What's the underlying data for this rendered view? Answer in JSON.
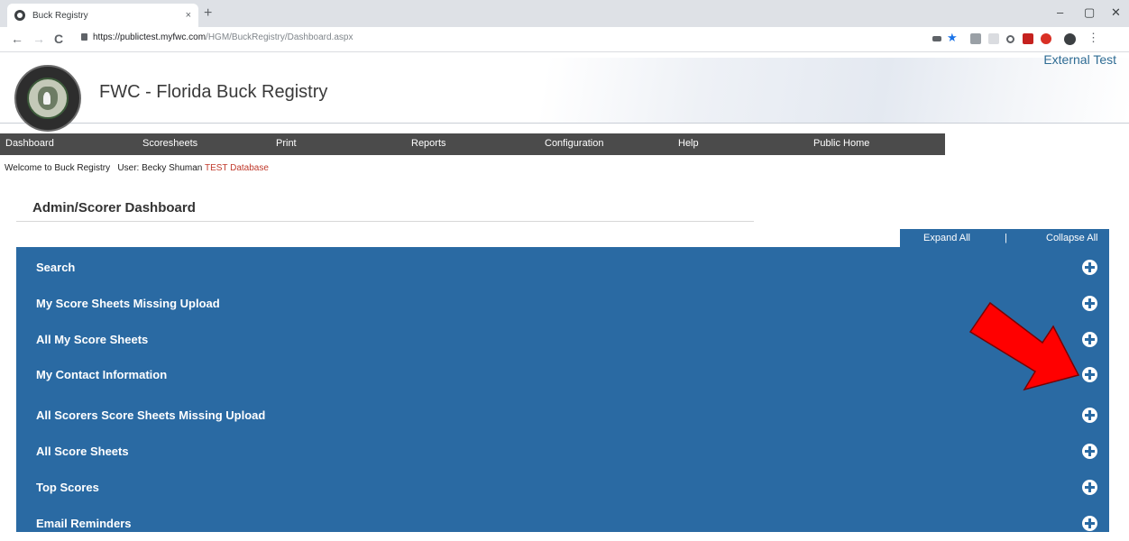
{
  "browser": {
    "tab_title": "Buck Registry",
    "tab_close": "×",
    "new_tab": "+",
    "url_host": "https://publictest.myfwc.com",
    "url_path": "/HGM/BuckRegistry/Dashboard.aspx",
    "window_min": "–",
    "window_max": "▢",
    "window_close": "✕",
    "back": "←",
    "forward": "→",
    "reload": "C"
  },
  "header": {
    "environment": "External Test",
    "site_title": "FWC - Florida Buck Registry"
  },
  "nav": {
    "items": [
      {
        "label": "Dashboard"
      },
      {
        "label": "Scoresheets"
      },
      {
        "label": "Print"
      },
      {
        "label": "Reports"
      },
      {
        "label": "Configuration"
      },
      {
        "label": "Help"
      },
      {
        "label": "Public Home"
      }
    ]
  },
  "welcome": {
    "text": "Welcome to Buck Registry",
    "user": "User: Becky Shuman",
    "database": "TEST Database"
  },
  "dashboard": {
    "title": "Admin/Scorer Dashboard",
    "expand_all": "Expand All",
    "separator": "|",
    "collapse_all": "Collapse All",
    "panels": [
      {
        "label": "Search"
      },
      {
        "label": "My Score Sheets Missing Upload"
      },
      {
        "label": "All My Score Sheets"
      },
      {
        "label": "My Contact Information"
      },
      {
        "label": "All Scorers Score Sheets Missing Upload"
      },
      {
        "label": "All Score Sheets"
      },
      {
        "label": "Top Scores"
      },
      {
        "label": "Email Reminders"
      }
    ]
  },
  "colors": {
    "panel_blue": "#2a6aa3",
    "nav_gray": "#4b4b4b",
    "arrow_red": "#ff0000"
  }
}
